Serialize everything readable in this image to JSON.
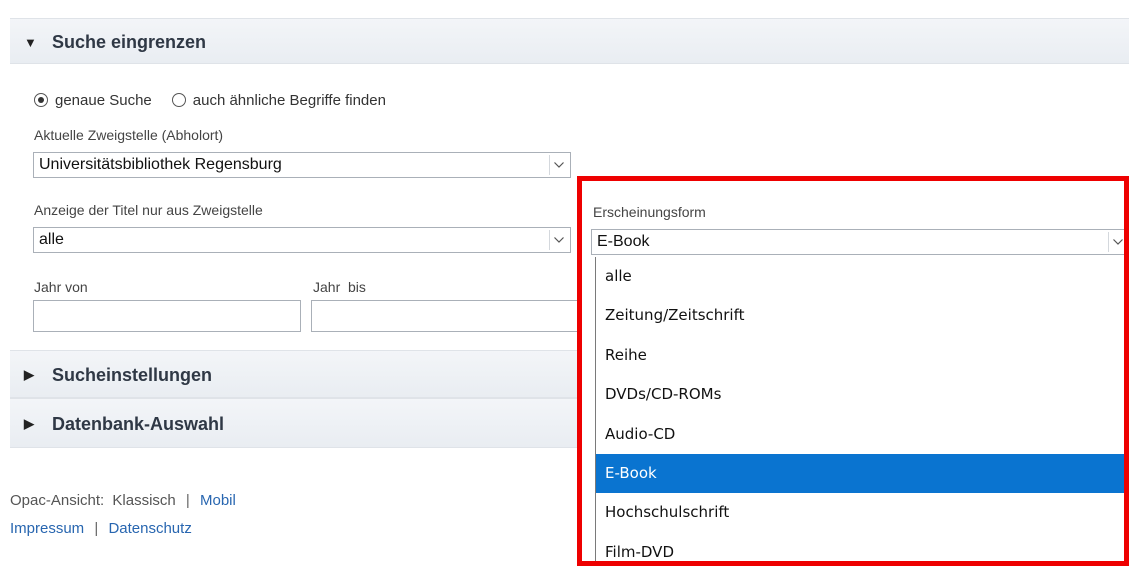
{
  "filter_panel": {
    "header": "Suche eingrenzen",
    "radio_exact": "genaue Suche",
    "radio_similar": "auch ähnliche Begriffe finden",
    "branch_label": "Aktuelle Zweigstelle (Abholort)",
    "branch_value": "Universitätsbibliothek Regensburg",
    "display_label": "Anzeige der Titel nur aus Zweigstelle",
    "display_value": "alle",
    "year_from_label": "Jahr von",
    "year_to_label": "Jahr  bis",
    "form_label": "Erscheinungsform",
    "form_value": "E-Book",
    "form_options": [
      "alle",
      "Zeitung/Zeitschrift",
      "Reihe",
      "DVDs/CD-ROMs",
      "Audio-CD",
      "E-Book",
      "Hochschulschrift",
      "Film-DVD"
    ],
    "form_selected_index": 5
  },
  "collapsed_panels": {
    "settings": "Sucheinstellungen",
    "database": "Datenbank-Auswahl"
  },
  "footer": {
    "view_label": "Opac-Ansicht:",
    "view_classic": "Klassisch",
    "view_mobile": "Mobil",
    "separator": "|",
    "imprint": "Impressum",
    "privacy": "Datenschutz"
  },
  "icons": {
    "expanded": "triangle-down-icon",
    "collapsed": "triangle-right-icon",
    "select_arrow": "chevron-down-icon"
  },
  "colors": {
    "highlight": "#ee0000",
    "selected_option": "#0a74d0",
    "link": "#2866b0"
  }
}
